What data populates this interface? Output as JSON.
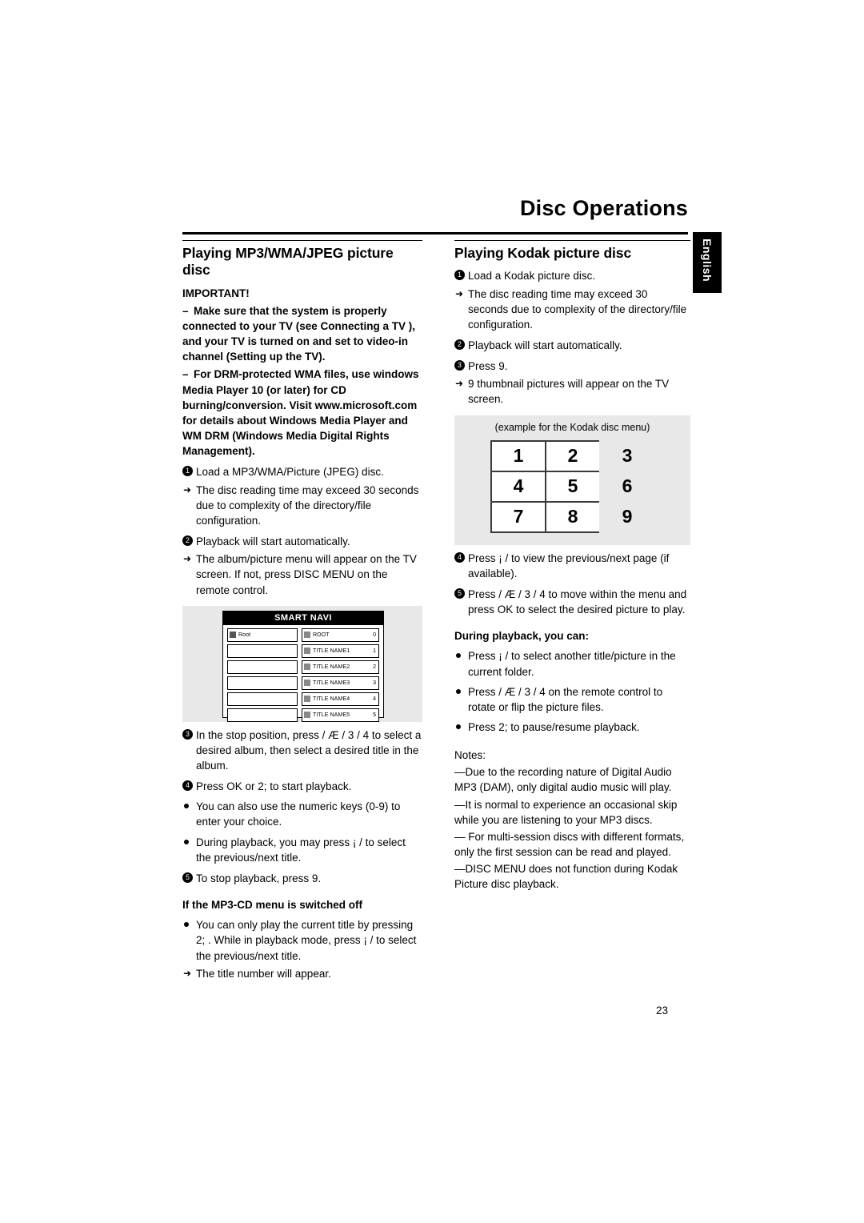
{
  "header": {
    "title": "Disc Operations",
    "side_tab": "English"
  },
  "left": {
    "heading": "Playing MP3/WMA/JPEG picture disc",
    "important_label": "IMPORTANT!",
    "important_items": [
      "Make sure that the system is properly connected to your TV (see Connecting a TV ), and your TV is turned on and set to video-in channel (Setting up the TV).",
      "For DRM-protected WMA files, use windows Media Player 10 (or later) for CD burning/conversion. Visit www.microsoft.com for details about Windows Media Player and WM DRM (Windows Media Digital Rights Management)."
    ],
    "step1": "Load a MP3/WMA/Picture (JPEG) disc.",
    "step1_sub": "The disc reading time may exceed 30 seconds due to complexity of the directory/file configuration.",
    "step2": "Playback will start automatically.",
    "step2_sub": "The album/picture menu will appear on the TV screen. If not, press DISC MENU on the remote control.",
    "figure": {
      "title": "SMART NAVI",
      "left_rows": [
        "Root",
        "",
        "",
        "",
        "",
        ""
      ],
      "right_rows": [
        {
          "label": "ROOT",
          "num": "0"
        },
        {
          "label": "TITLE NAME1",
          "num": "1"
        },
        {
          "label": "TITLE NAME2",
          "num": "2"
        },
        {
          "label": "TITLE NAME3",
          "num": "3"
        },
        {
          "label": "TITLE NAME4",
          "num": "4"
        },
        {
          "label": "TITLE NAME5",
          "num": "5"
        }
      ]
    },
    "step3": "In the stop position, press      / Æ  / 3  / 4  to select a desired album, then select a desired title in the album.",
    "step4": "Press OK or 2; to start playback.",
    "bullet1": "You can also use the numeric keys (0-9) to enter your choice.",
    "bullet2": "During playback, you may press ¡  /      to select the previous/next title.",
    "step5": "To stop playback, press 9.",
    "subhead": "If the MP3-CD menu is switched off",
    "bullet3": "You can only play the current title by pressing 2; . While in playback mode, press ¡  /      to select the previous/next title.",
    "bullet3_sub": "The title number will appear."
  },
  "right": {
    "heading": "Playing Kodak picture disc",
    "step1": "Load a Kodak picture disc.",
    "step1_sub": "The disc reading time may exceed 30 seconds due to complexity of the directory/file configuration.",
    "step2": "Playback will start automatically.",
    "step3": "Press 9.",
    "step3_sub": "9 thumbnail pictures will appear on the TV screen.",
    "figure": {
      "caption": "(example for the Kodak disc menu)",
      "cells": [
        "1",
        "2",
        "3",
        "4",
        "5",
        "6",
        "7",
        "8",
        "9"
      ]
    },
    "step4": "Press ¡  /      to view the previous/next page (if available).",
    "step5": "Press        / Æ  / 3  / 4  to move within the menu and press OK to select the desired picture to play.",
    "subhead": "During playback, you can:",
    "bullet1": "Press ¡  /      to select another title/picture in the current folder.",
    "bullet2": "Press        / Æ  / 3  / 4  on the remote control to rotate or flip the picture files.",
    "bullet3": "Press 2; to pause/resume playback.",
    "notes_label": "Notes:",
    "notes": [
      "—Due to the recording nature of Digital Audio MP3 (DAM), only digital audio music will play.",
      "—It is normal to experience an occasional  skip while you are listening to your MP3 discs.",
      "— For multi-session discs with different formats, only the first session can be read and played.",
      "—DISC MENU does not function during Kodak Picture disc playback."
    ]
  },
  "page_number": "23"
}
